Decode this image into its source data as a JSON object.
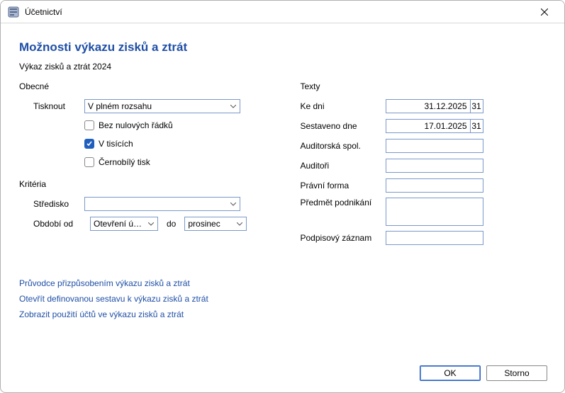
{
  "window": {
    "title": "Účetnictví"
  },
  "page": {
    "title": "Možnosti výkazu zisků a ztrát",
    "subtitle": "Výkaz zisků a ztrát 2024"
  },
  "general": {
    "group_label": "Obecné",
    "print_label": "Tisknout",
    "print_value": "V plném rozsahu",
    "cb_nozero": "Bez nulových řádků",
    "cb_thousands": "V tisících",
    "cb_bw": "Černobílý tisk"
  },
  "criteria": {
    "group_label": "Kritéria",
    "center_label": "Středisko",
    "center_value": "",
    "period_from_label": "Období od",
    "period_from_value": "Otevření účtu",
    "period_to_label": "do",
    "period_to_value": "prosinec"
  },
  "texts": {
    "group_label": "Texty",
    "ke_dni_label": "Ke dni",
    "ke_dni_value": "31.12.2025",
    "sestaveno_label": "Sestaveno dne",
    "sestaveno_value": "17.01.2025",
    "audit_spol_label": "Auditorská spol.",
    "audit_spol_value": "",
    "auditori_label": "Auditoři",
    "auditori_value": "",
    "pravni_forma_label": "Právní forma",
    "pravni_forma_value": "",
    "predmet_label": "Předmět podnikání",
    "predmet_value": "",
    "podpis_label": "Podpisový záznam",
    "podpis_value": ""
  },
  "date_btn_label": "31",
  "links": {
    "l1": "Průvodce přizpůsobením výkazu zisků a ztrát",
    "l2": "Otevřít definovanou sestavu k výkazu zisků a ztrát",
    "l3": "Zobrazit použití účtů ve výkazu zisků a ztrát"
  },
  "buttons": {
    "ok": "OK",
    "cancel": "Storno"
  }
}
